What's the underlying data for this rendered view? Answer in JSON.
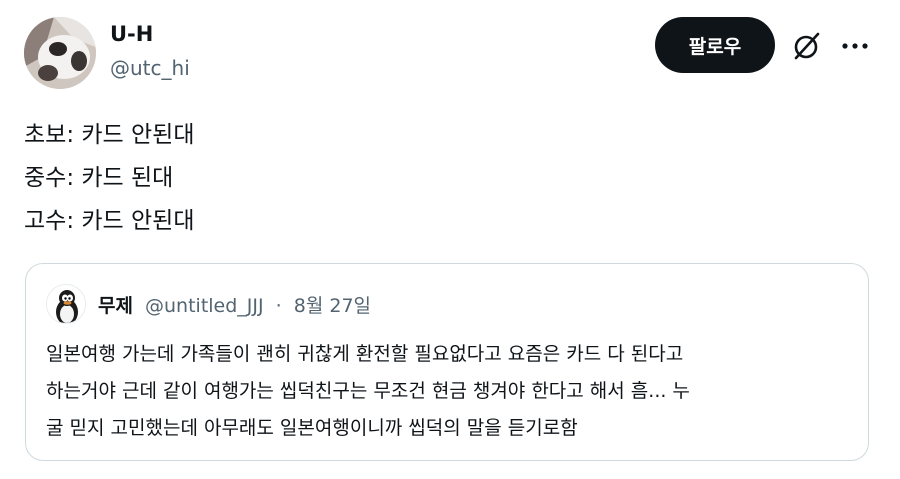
{
  "author": {
    "name": "U-H",
    "handle": "@utc_hi"
  },
  "actions": {
    "follow_label": "팔로우",
    "grok_icon": "grok-slash-icon",
    "more_icon": "more-horizontal-icon"
  },
  "post": {
    "lines": [
      "초보: 카드 안된대",
      "중수: 카드 된대",
      "고수: 카드 안된대"
    ]
  },
  "quote": {
    "name": "무제",
    "handle": "@untitled_JJJ",
    "separator": "·",
    "date": "8월 27일",
    "lines": [
      "일본여행 가는데 가족들이 괜히 귀찮게 환전할 필요없다고 요즘은 카드 다 된다고",
      "하는거야 근데 같이 여행가는 씹덕친구는 무조건 현금 챙겨야 한다고 해서 흠... 누",
      "굴 믿지 고민했는데 아무래도 일본여행이니까 씹덕의 말을 듣기로함"
    ]
  },
  "colors": {
    "text": "#0f1419",
    "secondary": "#536471",
    "button_bg": "#0f1419",
    "border": "#cfd9de"
  }
}
